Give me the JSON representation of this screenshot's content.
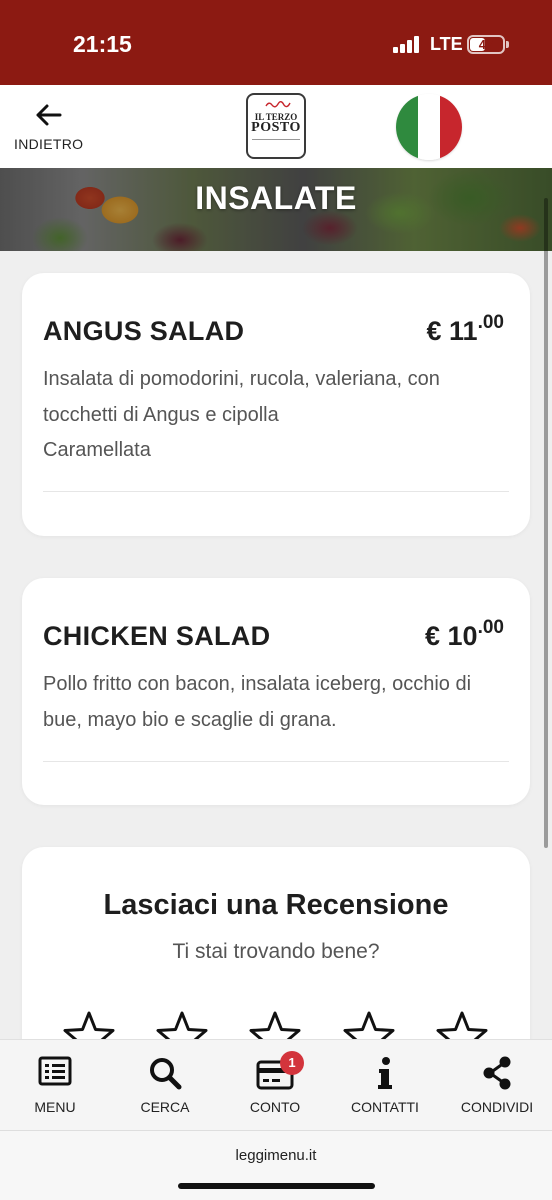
{
  "status_bar": {
    "time": "21:15",
    "network": "LTE",
    "battery": "47",
    "battery_level": 0.47,
    "background_color": "#8c1a12"
  },
  "header": {
    "back_label": "INDIETRO",
    "back_icon": "arrow-left-icon",
    "logo": {
      "line1": "IL TERZO",
      "line2": "POSTO"
    },
    "language_flag": "italy-flag-icon",
    "flag_colors": [
      "#2f8a3e",
      "#ffffff",
      "#c7262d"
    ]
  },
  "banner": {
    "title": "INSALATE"
  },
  "menu_items": [
    {
      "name": "ANGUS SALAD",
      "price_main": "€ 11",
      "price_cents": ".00",
      "description": "Insalata di pomodorini, rucola, valeriana, con tocchetti di Angus e cipolla\nCaramellata"
    },
    {
      "name": "CHICKEN SALAD",
      "price_main": "€ 10",
      "price_cents": ".00",
      "description": "Pollo fritto con bacon, insalata iceberg, occhio di bue, mayo bio e scaglie di grana."
    }
  ],
  "review": {
    "title": "Lasciaci una Recensione",
    "subtitle": "Ti stai trovando bene?",
    "star_count": 5,
    "rating": 0
  },
  "bottom_nav": [
    {
      "label": "MENU",
      "icon": "list-icon"
    },
    {
      "label": "CERCA",
      "icon": "search-icon"
    },
    {
      "label": "CONTO",
      "icon": "credit-card-icon",
      "badge": "1"
    },
    {
      "label": "CONTATTI",
      "icon": "info-icon"
    },
    {
      "label": "CONDIVIDI",
      "icon": "share-icon"
    }
  ],
  "browser": {
    "url": "leggimenu.it"
  }
}
